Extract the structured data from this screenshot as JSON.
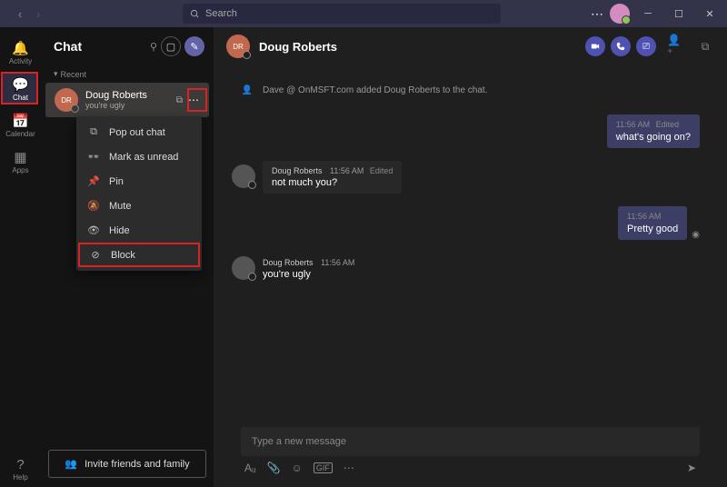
{
  "titlebar": {
    "search_placeholder": "Search"
  },
  "rail": {
    "activity": "Activity",
    "chat": "Chat",
    "calendar": "Calendar",
    "apps": "Apps",
    "help": "Help"
  },
  "sidebar": {
    "title": "Chat",
    "recent_label": "Recent",
    "chat_item": {
      "initials": "DR",
      "name": "Doug Roberts",
      "preview": "you're ugly"
    },
    "invite_label": "Invite friends and family"
  },
  "context_menu": {
    "popout": "Pop out chat",
    "unread": "Mark as unread",
    "pin": "Pin",
    "mute": "Mute",
    "hide": "Hide",
    "block": "Block"
  },
  "chat_header": {
    "initials": "DR",
    "name": "Doug Roberts"
  },
  "messages": {
    "system": "Dave @ OnMSFT.com added Doug Roberts to the chat.",
    "sent1_time": "11:56 AM",
    "sent1_edited": "Edited",
    "sent1_text": "what's going on?",
    "recv1_name": "Doug Roberts",
    "recv1_time": "11:56 AM",
    "recv1_edited": "Edited",
    "recv1_text": "not much you?",
    "sent2_time": "11:56 AM",
    "sent2_text": "Pretty good",
    "recv2_name": "Doug Roberts",
    "recv2_time": "11:56 AM",
    "recv2_text": "you're ugly"
  },
  "compose": {
    "placeholder": "Type a new message"
  }
}
